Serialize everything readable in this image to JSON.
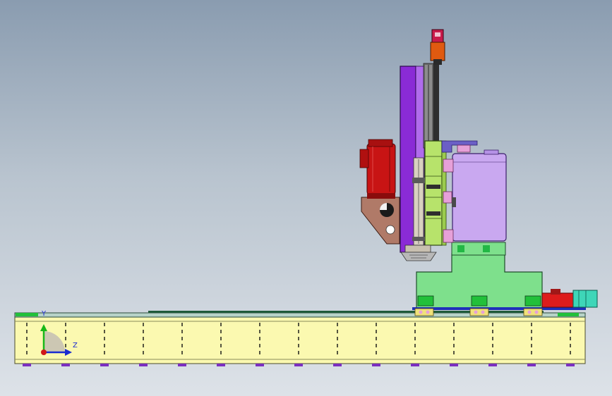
{
  "triad": {
    "y_label": "Y",
    "z_label": "Z"
  },
  "colors": {
    "background_top": "#8a9cb0",
    "background_bottom": "#dde2e8",
    "base_bed": "#fbf9b0",
    "rail": "#2f8f5c",
    "saddle": "#7ee08c",
    "column_plate": "#8a2bd6",
    "headstock": "#c9a8f0",
    "spindle_carriage": "#b7e36b",
    "motor": "#c81414",
    "motor_bracket": "#b07a68",
    "top_motor": "#e05a10",
    "gear_motor": "#dd1c1c",
    "coupling": "#3ed6b8",
    "bolts": "#7b2fbf"
  }
}
